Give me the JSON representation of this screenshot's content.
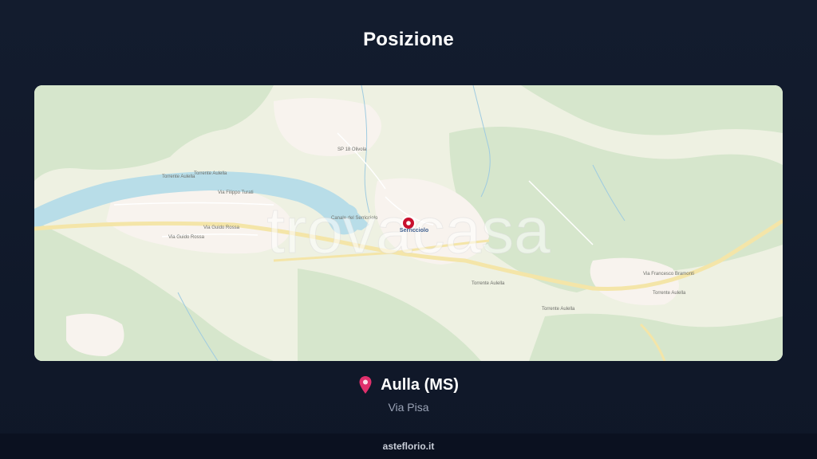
{
  "page": {
    "title": "Posizione"
  },
  "map": {
    "watermark": "trovacasa",
    "marker_label": "Serricciolo",
    "street_labels": {
      "filippo_turati": "Via Filippo Turati",
      "guido_rossa_1": "Via Guido Rossa",
      "guido_rossa_2": "Via Guido Rossa",
      "aulella_1": "Torrente Aulella",
      "aulella_2": "Torrente Aulella",
      "aulella_3": "Torrente Aulella",
      "aulella_4": "Torrente Aulella",
      "aulella_5": "Torrente Aulella",
      "francesco_bramonti": "Via Francesco Bramonti",
      "olivola": "SP 18 Olivola",
      "lake": "Canale del Serricciolo"
    },
    "colors": {
      "land": "#eef1e2",
      "forest": "#d6e6cc",
      "urban": "#f8f3ee",
      "river": "#b8dde8",
      "road_main": "#f4e5a8",
      "marker": "#c8102e"
    }
  },
  "location": {
    "pin_icon": "map-pin-icon",
    "city": "Aulla (MS)",
    "street": "Via Pisa"
  },
  "footer": {
    "site": "asteflorio.it"
  }
}
